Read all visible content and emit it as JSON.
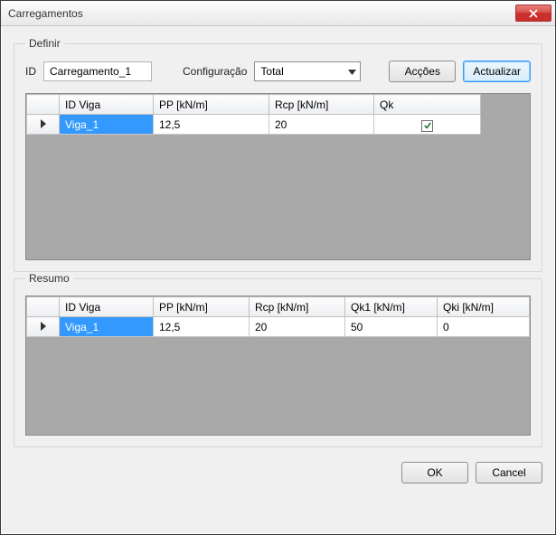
{
  "window": {
    "title": "Carregamentos"
  },
  "definir": {
    "legend": "Definir",
    "id_label": "ID",
    "id_value": "Carregamento_1",
    "config_label": "Configuração",
    "config_value": "Total",
    "accoes_label": "Acções",
    "actualizar_label": "Actualizar",
    "columns": {
      "id_viga": "ID Viga",
      "pp": "PP [kN/m]",
      "rcp": "Rcp [kN/m]",
      "qk": "Qk"
    },
    "rows": [
      {
        "id_viga": "Viga_1",
        "pp": "12,5",
        "rcp": "20",
        "qk_checked": true
      }
    ]
  },
  "resumo": {
    "legend": "Resumo",
    "columns": {
      "id_viga": "ID Viga",
      "pp": "PP [kN/m]",
      "rcp": "Rcp [kN/m]",
      "qk1": "Qk1 [kN/m]",
      "qki": "Qki [kN/m]"
    },
    "rows": [
      {
        "id_viga": "Viga_1",
        "pp": "12,5",
        "rcp": "20",
        "qk1": "50",
        "qki": "0"
      }
    ]
  },
  "footer": {
    "ok": "OK",
    "cancel": "Cancel"
  }
}
